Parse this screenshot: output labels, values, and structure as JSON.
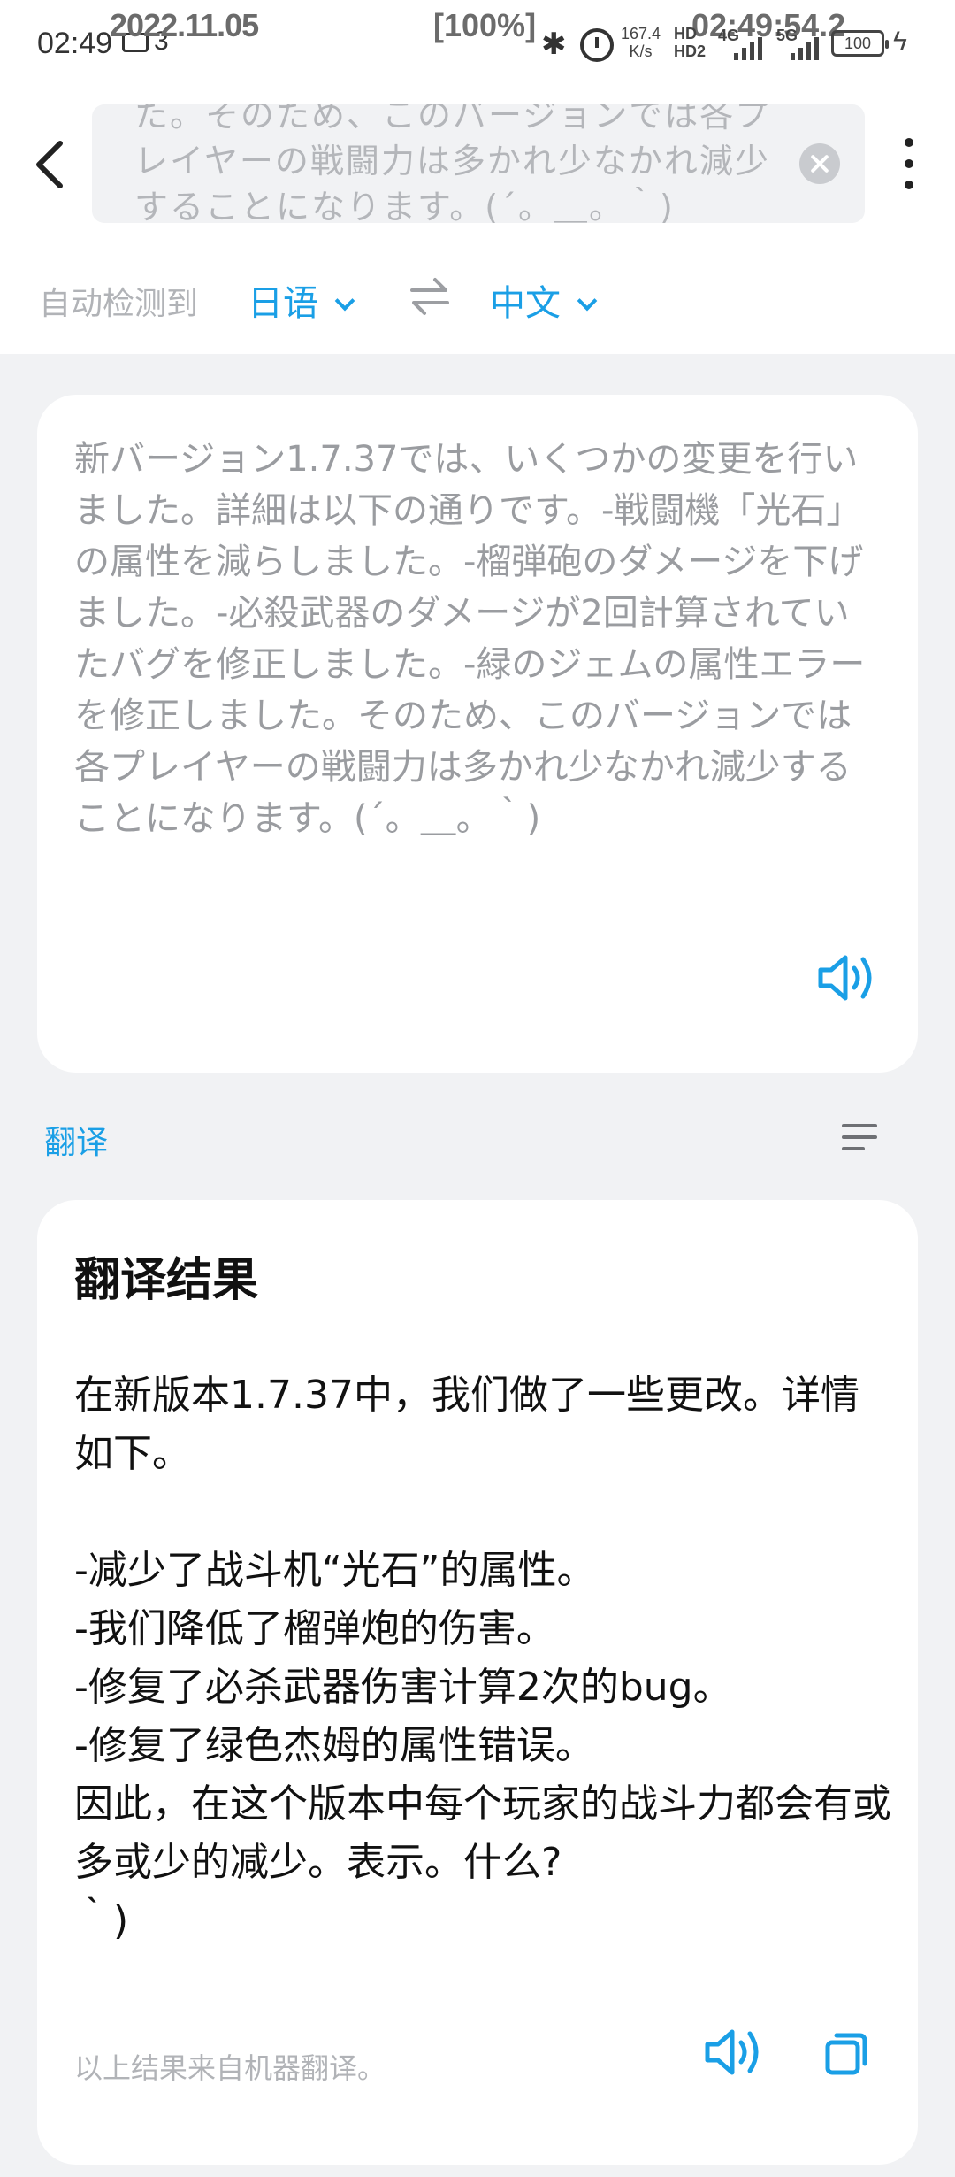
{
  "status_bar": {
    "time": "02:49",
    "notification_count": "3",
    "overlay_date": "2022.11.05",
    "overlay_battery": "[100%]",
    "overlay_clock": "02:49:54.2",
    "net_speed_value": "167.4",
    "net_speed_unit": "K/s",
    "hd1": "HD",
    "hd2": "HD2",
    "network_4g": "4G",
    "network_5g": "5G",
    "battery": "100"
  },
  "header": {
    "search_text": "た。そのため、このバージョンでは各プレイヤーの戦闘力は多かれ少なかれ減少することになります。(´。＿。｀)"
  },
  "language_bar": {
    "auto_detect_label": "自动检测到",
    "source_language": "日语",
    "target_language": "中文"
  },
  "source": {
    "text": "新バージョン1.7.37では、いくつかの変更を行いました。詳細は以下の通りです。-戦闘機「光石」の属性を減らしました。-榴弾砲のダメージを下げました。-必殺武器のダメージが2回計算されていたバグを修正しました。-緑のジェムの属性エラーを修正しました。そのため、このバージョンでは各プレイヤーの戦闘力は多かれ少なかれ減少することになります。(´。＿。｀)"
  },
  "translation_section": {
    "label": "翻译"
  },
  "result": {
    "title": "翻译结果",
    "text": "在新版本1.7.37中，我们做了一些更改。详情如下。\n\n-减少了战斗机“光石”的属性。\n-我们降低了榴弹炮的伤害。\n-修复了必杀武器伤害计算2次的bug。\n-修复了绿色杰姆的属性错误。\n因此，在这个版本中每个玩家的战斗力都会有或多或少的减少。表示。什么?\n｀)",
    "note": "以上结果来自机器翻译。"
  },
  "colors": {
    "accent": "#1a9fe6",
    "page_background": "#f1f2f4",
    "card_background": "#ffffff"
  },
  "icons": [
    "back-arrow-icon",
    "clear-icon",
    "more-vertical-icon",
    "swap-icon",
    "speaker-icon",
    "list-menu-icon",
    "copy-icon",
    "bluetooth-icon",
    "alarm-icon",
    "battery-icon",
    "charging-icon"
  ]
}
